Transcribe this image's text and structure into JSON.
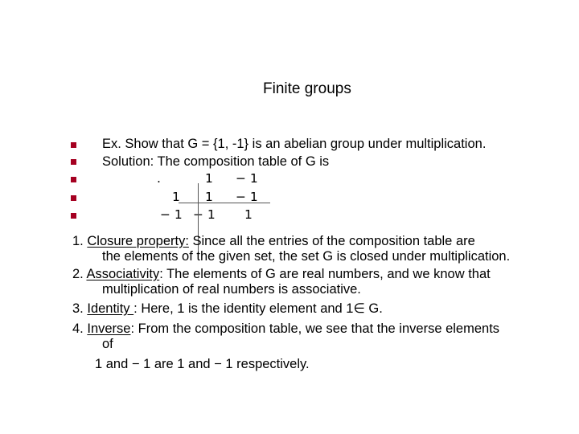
{
  "slide": {
    "title": "Finite groups",
    "bullets": [
      "Ex. Show that  G = {1, -1} is an abelian group under multiplication.",
      "Solution: The composition table of G is"
    ],
    "bullet_color": "#a50021",
    "table": {
      "header": [
        ".",
        "1",
        "− 1"
      ],
      "rows": [
        [
          "1",
          "1",
          "− 1"
        ],
        [
          "− 1",
          "− 1",
          "1"
        ]
      ]
    },
    "properties": [
      {
        "number": "1.",
        "name": "Closure property:",
        "line1": "  Since all the entries of the composition table are",
        "line2": "the elements of the given set, the set G is closed under multiplication."
      },
      {
        "number": "2.",
        "name": "Associativity",
        "line1": ":  The elements of G are real numbers, and we know that",
        "line2": "multiplication of real numbers is  associative."
      },
      {
        "number": "3.",
        "name": "Identity ",
        "line1": ":  Here,  1  is the identity element and  1∈ G."
      },
      {
        "number": "4.",
        "name": "Inverse",
        "line1": ": From the composition table, we see that the inverse elements",
        "line2": "of",
        "line3": "1 and  − 1  are  1 and  − 1 respectively."
      }
    ]
  }
}
